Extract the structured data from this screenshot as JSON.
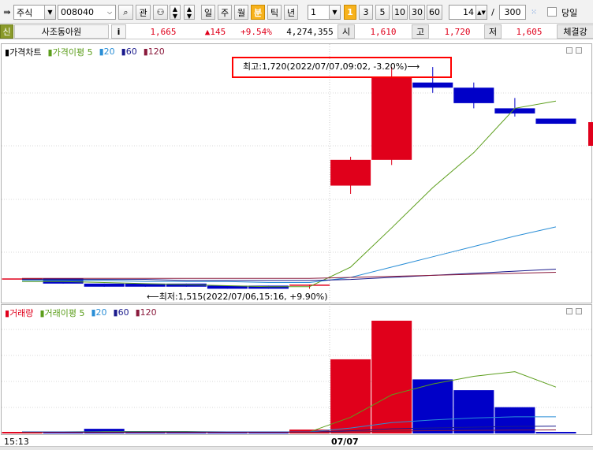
{
  "toolbar": {
    "market": "주식",
    "code": "008040",
    "btn_gwan": "관",
    "periods": [
      "일",
      "주",
      "월",
      "분",
      "틱",
      "년"
    ],
    "active_period": "분",
    "interval_value": "1",
    "minute_buttons": [
      "1",
      "3",
      "5",
      "10",
      "30",
      "60"
    ],
    "active_minute": "1",
    "count_value": "14",
    "slash": "/",
    "max_value": "300",
    "today_label": "당일"
  },
  "quote": {
    "badge": "신",
    "name": "사조동아원",
    "info": "i",
    "price": "1,665",
    "change": "▲145",
    "rate": "+9.54%",
    "volume": "4,274,355",
    "open_label": "시",
    "open": "1,610",
    "high_label": "고",
    "high": "1,720",
    "low_label": "저",
    "low": "1,605",
    "more": "체결강"
  },
  "price_panel": {
    "title": "가격차트",
    "ma_label": "가격이평 5",
    "ma_periods": [
      "20",
      "60",
      "120"
    ],
    "max_note": "최고:1,720(2022/07/07,09:02, -3.20%)⟶",
    "min_note": "⟵최저:1,515(2022/07/06,15:16, +9.90%)"
  },
  "volume_panel": {
    "title": "거래량",
    "ma_label": "거래이평 5",
    "ma_periods": [
      "20",
      "60",
      "120"
    ]
  },
  "xaxis": {
    "left_label": "15:13",
    "date_label": "07/07"
  },
  "colors": {
    "up": "#e0001b",
    "down": "#0000c8",
    "ma5": "#5c9e1c",
    "ma20": "#2a8ed6",
    "ma60": "#1a1a8c",
    "ma120": "#8a1a3c"
  },
  "chart_data": [
    {
      "type": "candlestick",
      "title": "가격차트",
      "series": [
        {
          "name": "가격차트",
          "candles": [
            {
              "o": 1515,
              "h": 1515,
              "l": 1515,
              "c": 1515
            },
            {
              "o": 1515,
              "h": 1515,
              "l": 1510,
              "c": 1510
            },
            {
              "o": 1510,
              "h": 1510,
              "l": 1507,
              "c": 1507
            },
            {
              "o": 1510,
              "h": 1510,
              "l": 1507,
              "c": 1507
            },
            {
              "o": 1510,
              "h": 1510,
              "l": 1507,
              "c": 1507
            },
            {
              "o": 1508,
              "h": 1508,
              "l": 1505,
              "c": 1505
            },
            {
              "o": 1508,
              "h": 1508,
              "l": 1505,
              "c": 1505
            },
            {
              "o": 1508,
              "h": 1509,
              "l": 1505,
              "c": 1509
            },
            {
              "o": 1605,
              "h": 1633,
              "l": 1597,
              "c": 1630
            },
            {
              "o": 1630,
              "h": 1720,
              "l": 1625,
              "c": 1710
            },
            {
              "o": 1705,
              "h": 1720,
              "l": 1695,
              "c": 1700
            },
            {
              "o": 1700,
              "h": 1705,
              "l": 1680,
              "c": 1685
            },
            {
              "o": 1680,
              "h": 1690,
              "l": 1672,
              "c": 1675
            },
            {
              "o": 1670,
              "h": 1670,
              "l": 1665,
              "c": 1665
            }
          ]
        },
        {
          "name": "가격이평 5",
          "values": [
            1512,
            1512,
            1511,
            1510,
            1509,
            1508,
            1507,
            1507,
            1526,
            1564,
            1603,
            1637,
            1680,
            1687
          ]
        },
        {
          "name": "20",
          "values": [
            1513,
            1513,
            1513,
            1512,
            1512,
            1512,
            1511,
            1511,
            1516,
            1526,
            1536,
            1546,
            1556,
            1565
          ]
        },
        {
          "name": "60",
          "values": [
            1514,
            1514,
            1514,
            1514,
            1513,
            1513,
            1513,
            1513,
            1514,
            1516,
            1518,
            1520,
            1522,
            1524
          ]
        },
        {
          "name": "120",
          "values": [
            1515,
            1515,
            1515,
            1515,
            1515,
            1515,
            1515,
            1515,
            1516,
            1517,
            1518,
            1519,
            1520,
            1521
          ]
        }
      ],
      "ylim": [
        1490,
        1730
      ]
    },
    {
      "type": "bar",
      "title": "거래량",
      "series": [
        {
          "name": "거래량",
          "values": [
            20000,
            20000,
            60000,
            10000,
            10000,
            10000,
            10000,
            50000,
            960000,
            1460000,
            700000,
            560000,
            340000,
            20000
          ]
        },
        {
          "name": "거래이평 5",
          "values": [
            20000,
            20000,
            25000,
            25000,
            25000,
            20000,
            15000,
            20000,
            210000,
            500000,
            640000,
            740000,
            800000,
            600000
          ]
        },
        {
          "name": "20",
          "values": [
            20000,
            20000,
            20000,
            20000,
            20000,
            20000,
            20000,
            20000,
            70000,
            140000,
            175000,
            200000,
            215000,
            215000
          ]
        },
        {
          "name": "60",
          "values": [
            18000,
            18000,
            18000,
            18000,
            18000,
            18000,
            18000,
            18000,
            35000,
            60000,
            72000,
            82000,
            90000,
            95000
          ]
        },
        {
          "name": "120",
          "values": [
            15000,
            15000,
            15000,
            15000,
            15000,
            15000,
            15000,
            15000,
            22000,
            30000,
            36000,
            40000,
            44000,
            46000
          ]
        }
      ],
      "ylim": [
        0,
        1500000
      ]
    }
  ]
}
